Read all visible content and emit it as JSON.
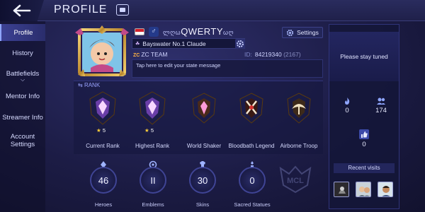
{
  "header": {
    "title": "PROFILE"
  },
  "sidebar": {
    "items": [
      {
        "label": "Profile",
        "active": true
      },
      {
        "label": "History"
      },
      {
        "label": "Battlefields"
      },
      {
        "label": "Mentor Info"
      },
      {
        "label": "Streamer Info"
      },
      {
        "label": "Account Settings"
      }
    ]
  },
  "profile": {
    "name": "QWERTY",
    "name_decor_left": "ლღω",
    "name_decor_right": "ωღ",
    "gender_symbol": "♂",
    "title": "Bayswater No.1 Claude",
    "team_tag": "ZC",
    "team_name": "ZC TEAM",
    "id_label": "ID:",
    "id_value": "84219340",
    "id_server": "(2167)",
    "state_message": "Tap here to edit your state message",
    "settings_label": "Settings"
  },
  "rank": {
    "heading": "RANK",
    "badges": [
      {
        "label": "Current Rank",
        "stars": "5"
      },
      {
        "label": "Highest Rank",
        "stars": "5"
      },
      {
        "label": "World Shaker"
      },
      {
        "label": "Bloodbath Legend"
      },
      {
        "label": "Airborne Troop"
      }
    ]
  },
  "stats": [
    {
      "label": "Heroes",
      "value": "46"
    },
    {
      "label": "Emblems",
      "value": "II"
    },
    {
      "label": "Skins",
      "value": "30"
    },
    {
      "label": "Sacred Statues",
      "value": "0"
    }
  ],
  "emblem_text": "MCL",
  "right_panel": {
    "stay_tuned": "Please stay tuned",
    "popularity": "0",
    "followers": "174",
    "likes": "0",
    "recent_visits_label": "Recent visits"
  },
  "colors": {
    "accent": "#8fa6ff",
    "gold": "#e2b64a",
    "background": "#1c1c45"
  }
}
